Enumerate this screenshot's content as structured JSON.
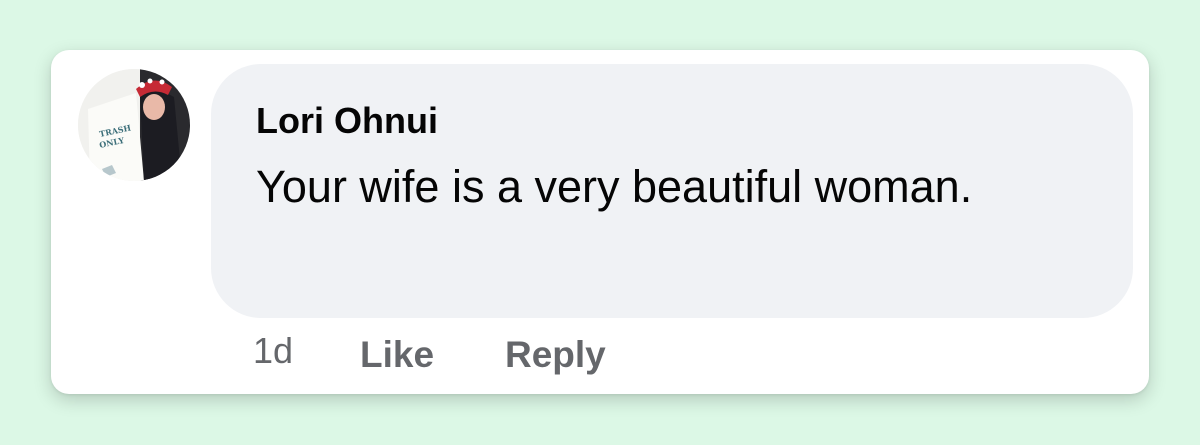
{
  "comment": {
    "author": "Lori Ohnui",
    "message": "Your wife is a very beautiful woman.",
    "timestamp": "1d",
    "like_label": "Like",
    "reply_label": "Reply",
    "avatar": {
      "icon": "profile-photo",
      "sign_text_line1": "TRASH",
      "sign_text_line2": "ONLY"
    }
  },
  "colors": {
    "background": "#dcf8e6",
    "card": "#ffffff",
    "bubble": "#f0f2f5",
    "text_primary": "#050505",
    "text_secondary": "#65676b"
  }
}
